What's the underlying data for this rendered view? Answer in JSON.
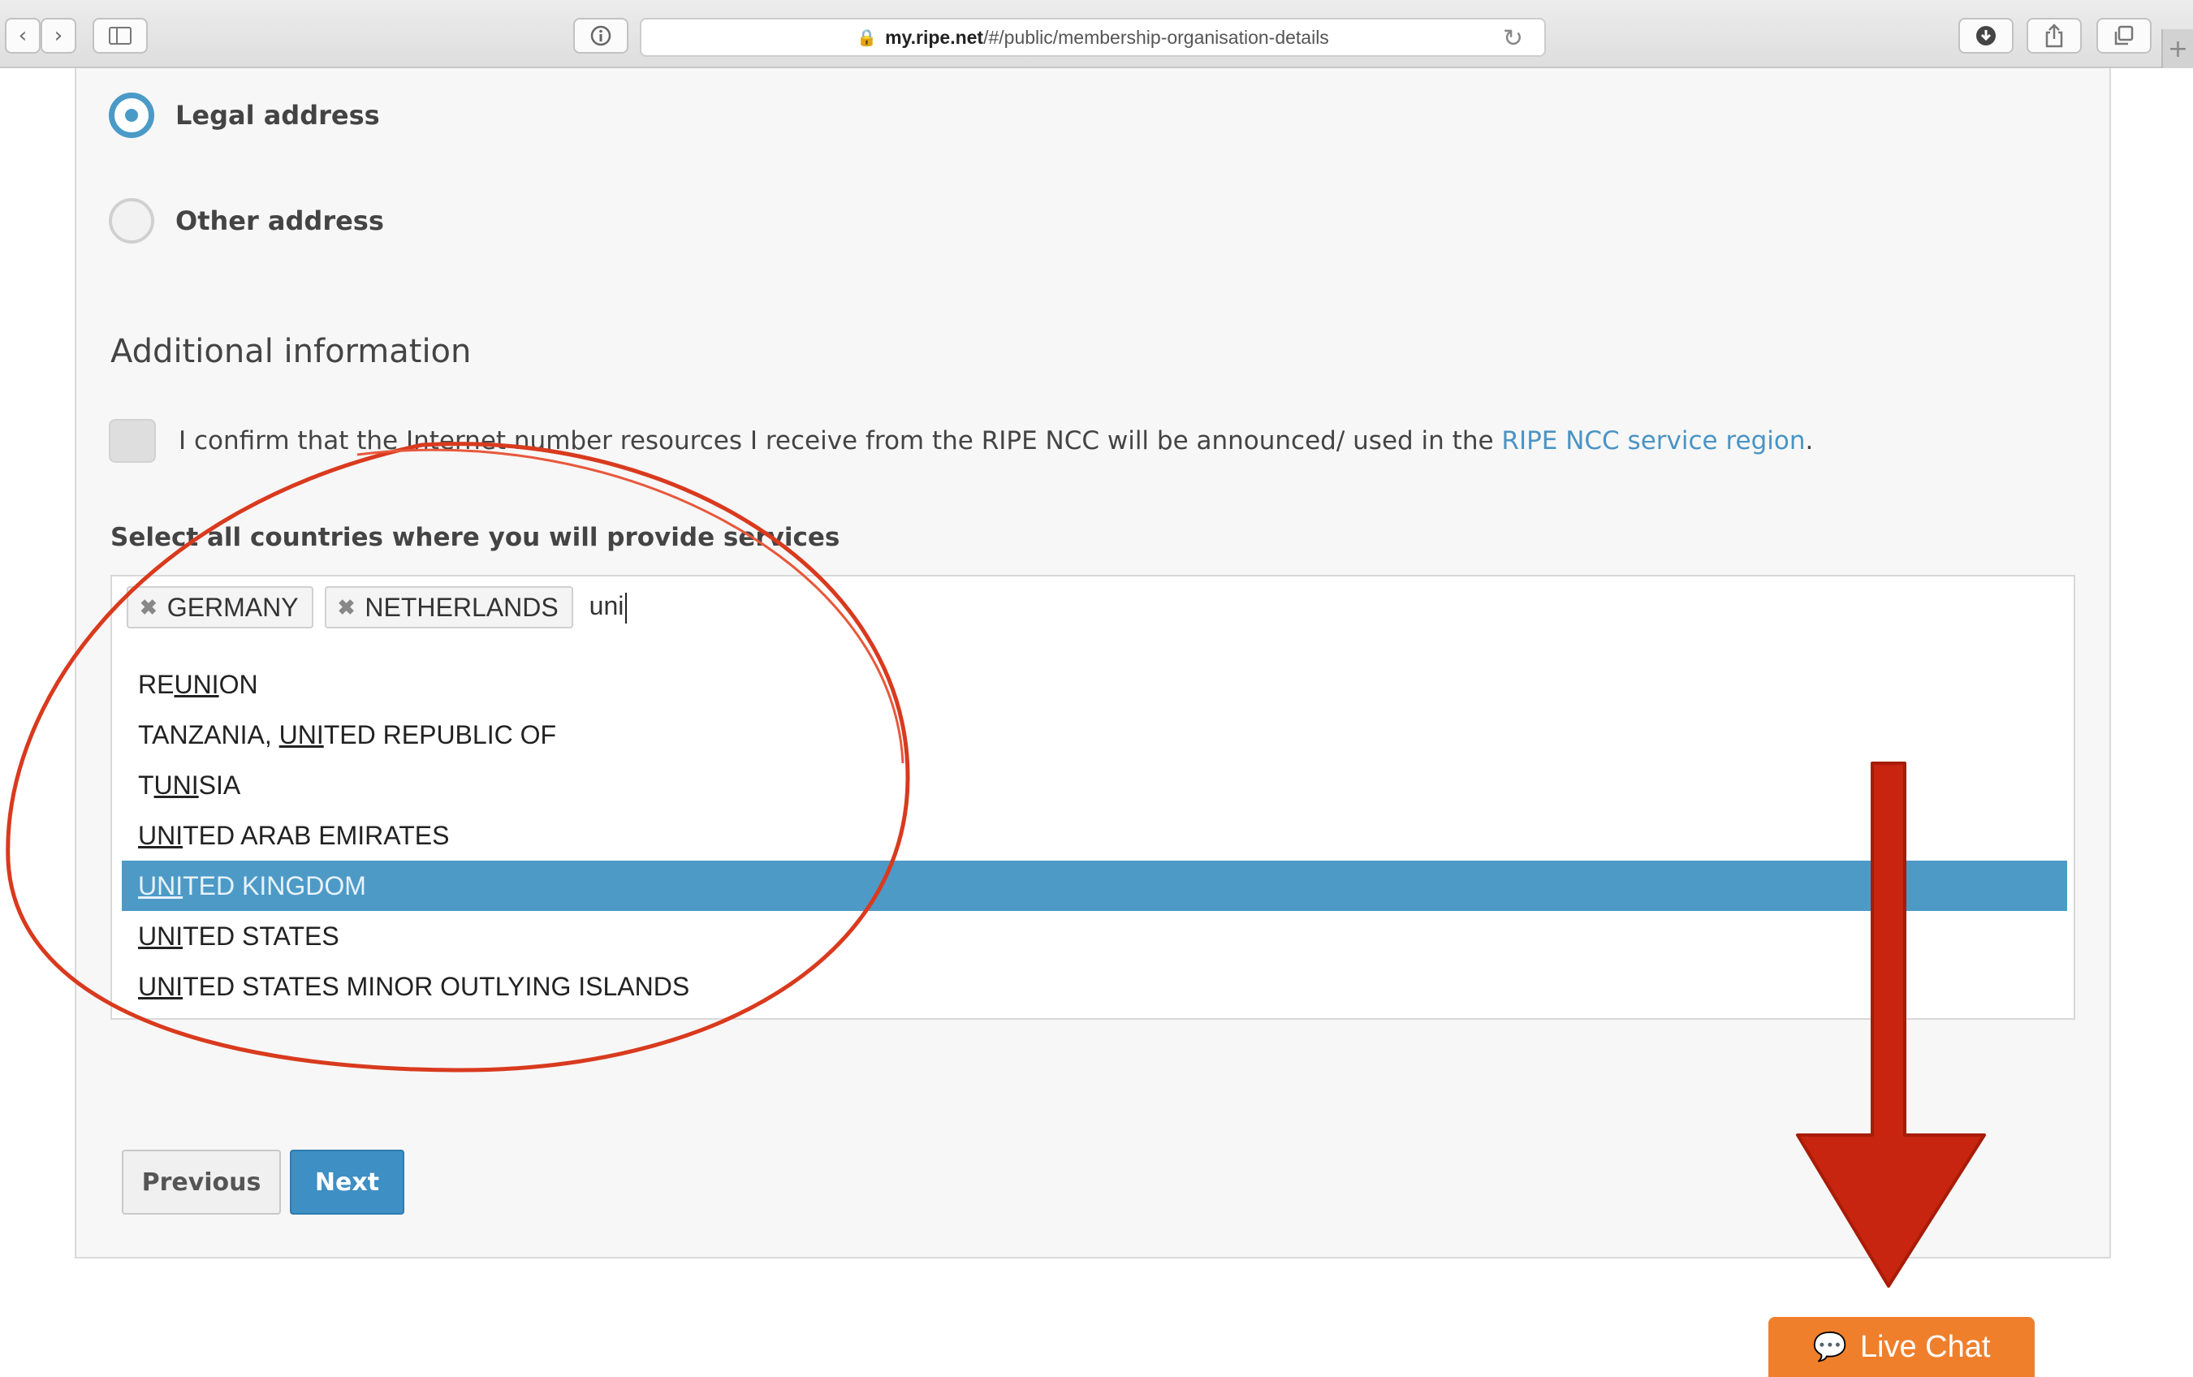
{
  "browser": {
    "url_domain": "my.ripe.net",
    "url_path": "/#/public/membership-organisation-details"
  },
  "address": {
    "legal_label": "Legal address",
    "other_label": "Other address",
    "selected": "legal"
  },
  "additional": {
    "title": "Additional information",
    "confirm_text": "I confirm that the Internet number resources I receive from the RIPE NCC will be announced/ used in the ",
    "confirm_link": "RIPE NCC service region",
    "confirm_suffix": "."
  },
  "countries": {
    "label": "Select all countries where you will provide services",
    "tags": [
      "GERMANY",
      "NETHERLANDS"
    ],
    "typed": "uni",
    "options": [
      {
        "pre": "RE",
        "match": "UNI",
        "post": "ON",
        "selected": false
      },
      {
        "pre": "TANZANIA, ",
        "match": "UNI",
        "post": "TED REPUBLIC OF",
        "selected": false
      },
      {
        "pre": "T",
        "match": "UNI",
        "post": "SIA",
        "selected": false
      },
      {
        "pre": "",
        "match": "UNI",
        "post": "TED ARAB EMIRATES",
        "selected": false
      },
      {
        "pre": "",
        "match": "UNI",
        "post": "TED KINGDOM",
        "selected": true
      },
      {
        "pre": "",
        "match": "UNI",
        "post": "TED STATES",
        "selected": false
      },
      {
        "pre": "",
        "match": "UNI",
        "post": "TED STATES MINOR OUTLYING ISLANDS",
        "selected": false
      }
    ]
  },
  "buttons": {
    "previous": "Previous",
    "next": "Next"
  },
  "live_chat": {
    "label": "Live Chat"
  },
  "colors": {
    "accent": "#4d9ac7",
    "annotation": "#d93a1e",
    "live_chat": "#f07f2c"
  }
}
